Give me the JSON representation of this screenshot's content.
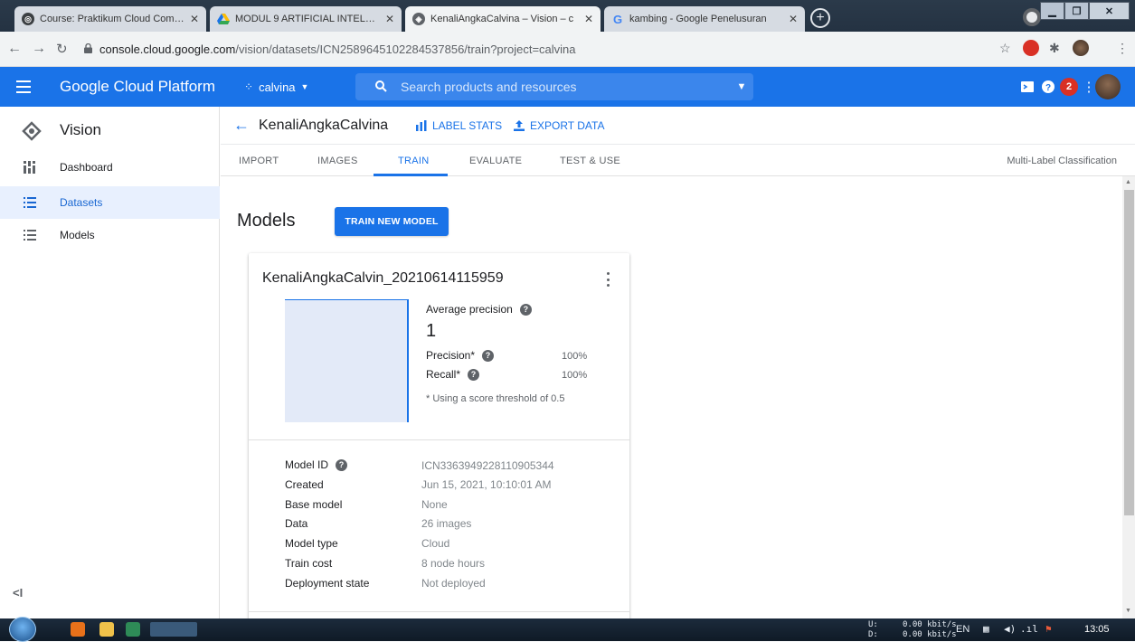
{
  "browser": {
    "tabs": [
      {
        "title": "Course: Praktikum Cloud Compu",
        "active": false
      },
      {
        "title": "MODUL 9 ARTIFICIAL INTELLIGEN",
        "active": false
      },
      {
        "title": "KenaliAngkaCalvina – Vision – c",
        "active": true
      },
      {
        "title": "kambing - Google Penelusuran",
        "active": false
      }
    ],
    "url_host": "console.cloud.google.com",
    "url_path": "/vision/datasets/ICN2589645102284537856/train?project=calvina",
    "notification_badge": "R"
  },
  "header": {
    "brand": "Google Cloud Platform",
    "project": "calvina",
    "search_placeholder": "Search products and resources",
    "notification_count": "2"
  },
  "sidebar": {
    "title": "Vision",
    "items": [
      {
        "label": "Dashboard",
        "icon": "dashboard-icon",
        "active": false
      },
      {
        "label": "Datasets",
        "icon": "list-icon",
        "active": true
      },
      {
        "label": "Models",
        "icon": "list-icon",
        "active": false
      }
    ],
    "collapse_label": "<I"
  },
  "dataset": {
    "name": "KenaliAngkaCalvina",
    "actions": {
      "label_stats": "LABEL STATS",
      "export_data": "EXPORT DATA"
    },
    "tabs": [
      "IMPORT",
      "IMAGES",
      "TRAIN",
      "EVALUATE",
      "TEST & USE"
    ],
    "active_tab": "TRAIN",
    "classification_type": "Multi-Label Classification"
  },
  "models": {
    "heading": "Models",
    "train_button": "TRAIN NEW MODEL",
    "card": {
      "name": "KenaliAngkaCalvin_20210614115959",
      "avg_precision_label": "Average precision",
      "avg_precision_value": "1",
      "precision_label": "Precision*",
      "precision_value": "100%",
      "recall_label": "Recall*",
      "recall_value": "100%",
      "threshold_note": "* Using a score threshold of 0.5",
      "details": [
        {
          "label": "Model ID",
          "value": "ICN3363949228110905344",
          "help": true
        },
        {
          "label": "Created",
          "value": "Jun 15, 2021, 10:10:01 AM",
          "help": false
        },
        {
          "label": "Base model",
          "value": "None",
          "help": false
        },
        {
          "label": "Data",
          "value": "26 images",
          "help": false
        },
        {
          "label": "Model type",
          "value": "Cloud",
          "help": false
        },
        {
          "label": "Train cost",
          "value": "8 node hours",
          "help": false
        },
        {
          "label": "Deployment state",
          "value": "Not deployed",
          "help": false
        }
      ]
    }
  },
  "taskbar": {
    "net_up_label": "U:",
    "net_down_label": "D:",
    "net_up": "0.00 kbit/s",
    "net_down": "0.00 kbit/s",
    "lang": "EN",
    "clock": "13:05"
  },
  "colors": {
    "gcp_blue": "#1a73e8",
    "active_nav_bg": "#e8f0fe",
    "notification_red": "#d93025"
  }
}
